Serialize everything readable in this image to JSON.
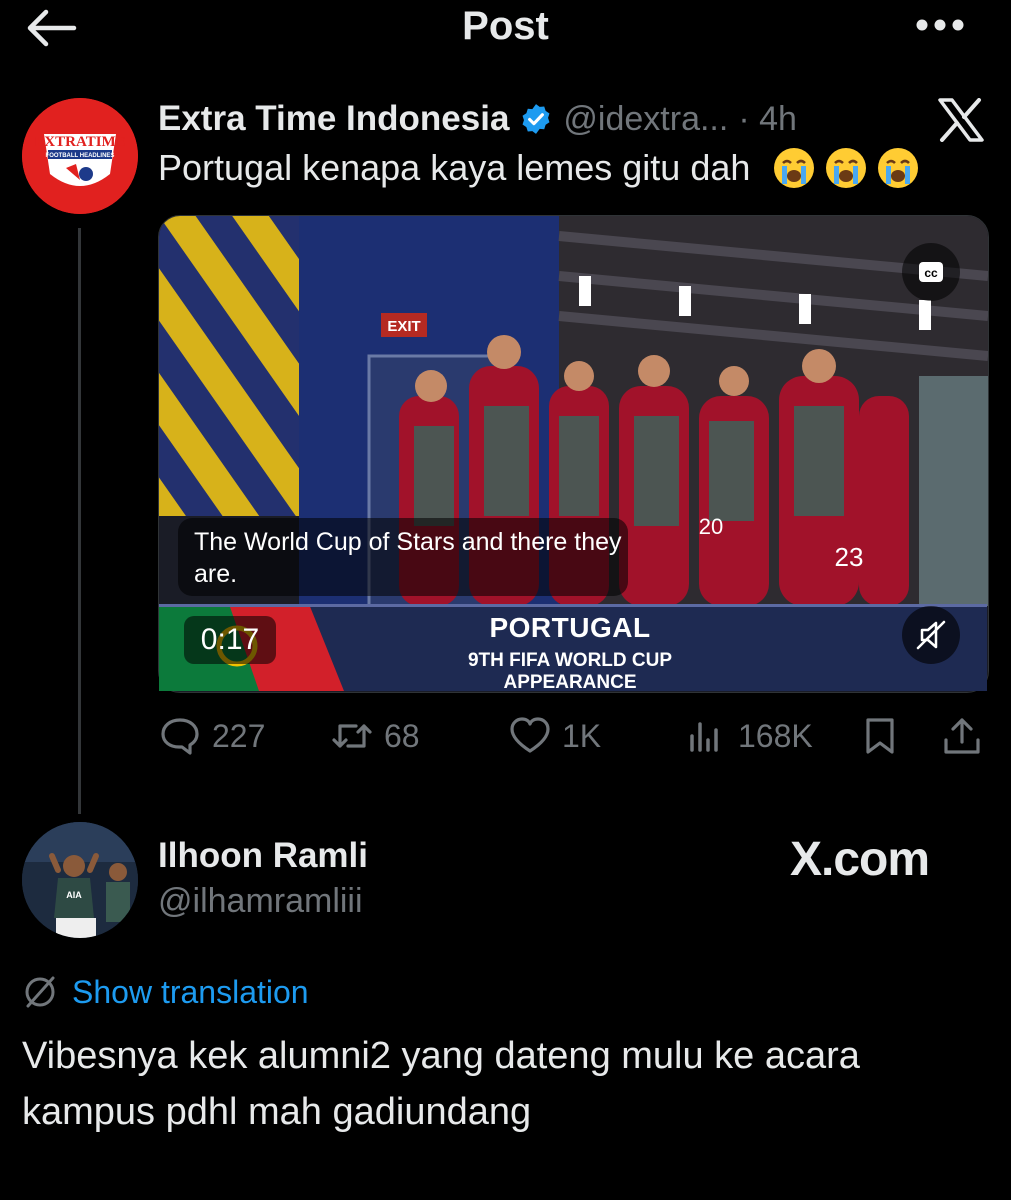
{
  "header": {
    "title": "Post",
    "back_icon": "arrow-left-icon",
    "more_icon": "more-horizontal-icon"
  },
  "quoted_post": {
    "author_name": "Extra Time Indonesia",
    "handle": "@idextra...",
    "time": "· 4h",
    "text": "Portugal kenapa kaya lemes gitu dah",
    "emojis": [
      "😭",
      "😭",
      "😭"
    ],
    "avatar": {
      "logo_top": "EXTRATIME",
      "logo_bottom": "FOOTBALL HEADLINES"
    },
    "video": {
      "caption": "The World Cup of Stars and there they are.",
      "exit_sign": "EXIT",
      "banner_title": "PORTUGAL",
      "banner_subtitle": "9TH FIFA WORLD CUP APPEARANCE",
      "time": "0:17",
      "cc_label": "cc",
      "jersey_numbers": [
        "20",
        "23"
      ]
    },
    "actions": {
      "replies": "227",
      "reposts": "68",
      "likes": "1K",
      "views": "168K"
    }
  },
  "reply": {
    "author_name": "Ilhoon Ramli",
    "handle": "@ilhamramliii",
    "watermark": "X.com",
    "translate_label": "Show translation",
    "text": "Vibesnya kek alumni2 yang dateng mulu ke acara kampus pdhl mah gadiundang",
    "avatar_shirt_text": "AIA"
  },
  "colors": {
    "background": "#000000",
    "text": "#e7e9ea",
    "muted": "#71767b",
    "accent": "#1d9bf0",
    "verified": "#1d9bf0",
    "logo_red": "#e1211f"
  }
}
